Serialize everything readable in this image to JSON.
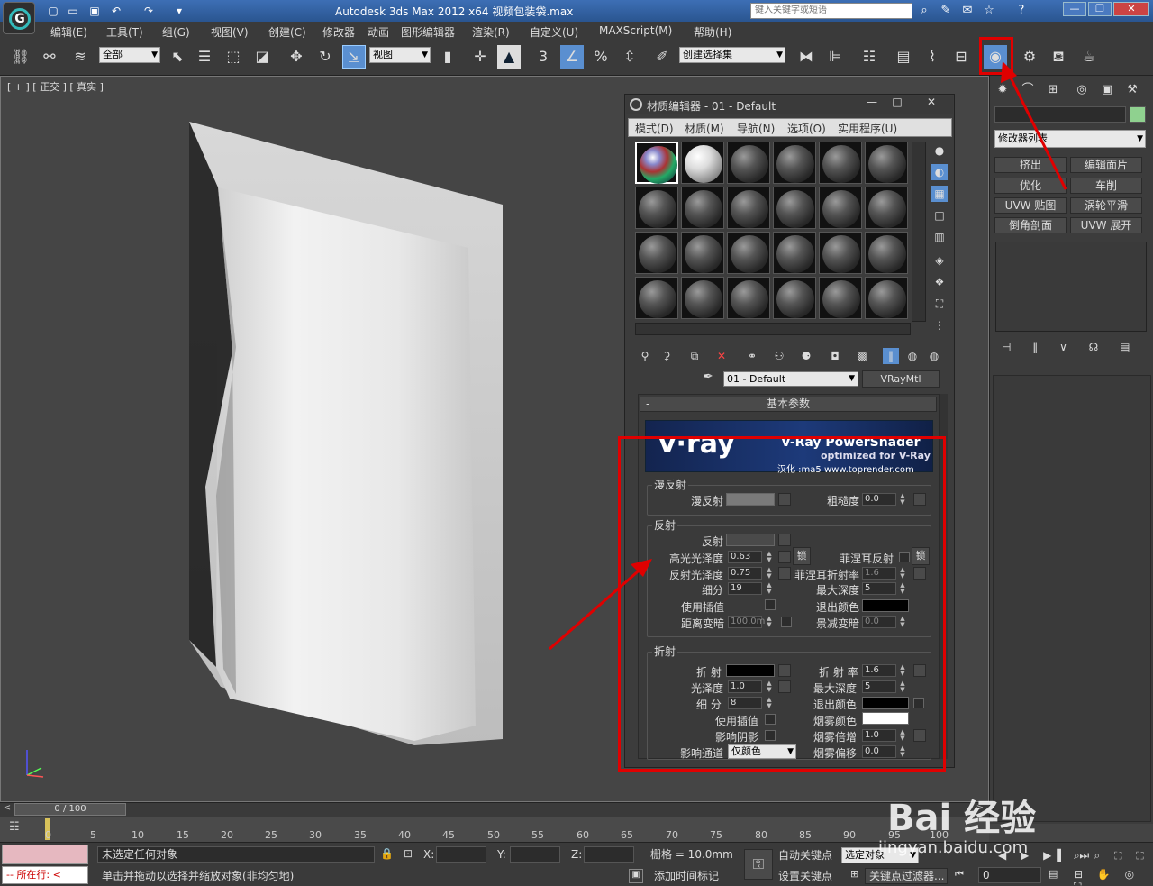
{
  "window": {
    "title": "Autodesk 3ds Max  2012 x64    视频包装袋.max",
    "search_placeholder": "键入关键字或短语"
  },
  "menubar": {
    "items": [
      "编辑(E)",
      "工具(T)",
      "组(G)",
      "视图(V)",
      "创建(C)",
      "修改器",
      "动画",
      "图形编辑器",
      "渲染(R)",
      "自定义(U)",
      "MAXScript(M)",
      "帮助(H)"
    ]
  },
  "toolbar": {
    "selection_filter": "全部",
    "ref_coord": "视图",
    "snap_label": "3",
    "named_selection": "创建选择集"
  },
  "viewport": {
    "label": "[ + ] [ 正交 ] [ 真实 ]"
  },
  "command_panel": {
    "modifier_list": "修改器列表",
    "buttons": [
      "挤出",
      "编辑面片",
      "优化",
      "车削",
      "UVW 贴图",
      "涡轮平滑",
      "倒角剖面",
      "UVW 展开"
    ],
    "color": "#8fd18f"
  },
  "material_editor": {
    "title": "材质编辑器 - 01 - Default",
    "menu": [
      "模式(D)",
      "材质(M)",
      "导航(N)",
      "选项(O)",
      "实用程序(U)"
    ],
    "material_name": "01 - Default",
    "material_type": "VRayMtl",
    "rollout_title": "基本参数",
    "banner": {
      "logo": "v·ray",
      "title": "V-Ray PowerShader",
      "subtitle": "optimized for V-Ray",
      "credit": "汉化 :ma5 www.toprender.com"
    },
    "diffuse": {
      "group": "漫反射",
      "diffuse_label": "漫反射",
      "roughness_label": "粗糙度",
      "roughness": "0.0",
      "diffuse_color": "#7a7a7a"
    },
    "reflection": {
      "group": "反射",
      "reflect_label": "反射",
      "reflect_color": "#4a4a4a",
      "hilight_gloss_label": "高光光泽度",
      "hilight_gloss": "0.63",
      "lock_label": "锁",
      "fresnel_label": "菲涅耳反射",
      "refl_gloss_label": "反射光泽度",
      "refl_gloss": "0.75",
      "fresnel_ior_label": "菲涅耳折射率",
      "fresnel_ior": "1.6",
      "subdivs_label": "细分",
      "subdivs": "19",
      "max_depth_label": "最大深度",
      "max_depth": "5",
      "use_interp_label": "使用插值",
      "exit_color_label": "退出颜色",
      "exit_color": "#000000",
      "dim_distance_label": "距离变暗",
      "dim_distance": "100.0m",
      "dim_falloff_label": "景减变暗",
      "dim_falloff": "0.0"
    },
    "refraction": {
      "group": "折射",
      "refract_label": "折 射",
      "refract_color": "#000000",
      "ior_label": "折 射 率",
      "ior": "1.6",
      "gloss_label": "光泽度",
      "gloss": "1.0",
      "max_depth_label": "最大深度",
      "max_depth": "5",
      "subdivs_label": "细 分",
      "subdivs": "8",
      "exit_color_label": "退出颜色",
      "exit_color": "#000000",
      "use_interp_label": "使用插值",
      "fog_color_label": "烟雾颜色",
      "fog_color": "#ffffff",
      "affect_shadows_label": "影响阴影",
      "fog_mult_label": "烟雾倍增",
      "fog_mult": "1.0",
      "affect_channels_label": "影响通道",
      "affect_channels": "仅颜色",
      "fog_bias_label": "烟雾偏移",
      "fog_bias": "0.0"
    }
  },
  "timeline": {
    "frame": "0 / 100",
    "ticks": [
      "0",
      "5",
      "10",
      "15",
      "20",
      "25",
      "30",
      "35",
      "40",
      "45",
      "50",
      "55",
      "60",
      "65",
      "70",
      "75",
      "80",
      "85",
      "90",
      "95",
      "100"
    ]
  },
  "status": {
    "running_label": "所在行:",
    "selection_status": "未选定任何对象",
    "prompt": "单击并拖动以选择并缩放对象(非均匀地)",
    "x_label": "X:",
    "y_label": "Y:",
    "z_label": "Z:",
    "grid": "栅格 = 10.0mm",
    "add_time_tag": "添加时间标记",
    "auto_key": "自动关键点",
    "set_key": "设置关键点",
    "selected_object": "选定对象",
    "key_filters": "关键点过滤器...",
    "frame_value": "0"
  },
  "watermark": {
    "brand": "Bai 经验",
    "url": "jingyan.baidu.com"
  },
  "annotation_color": "#e00000"
}
